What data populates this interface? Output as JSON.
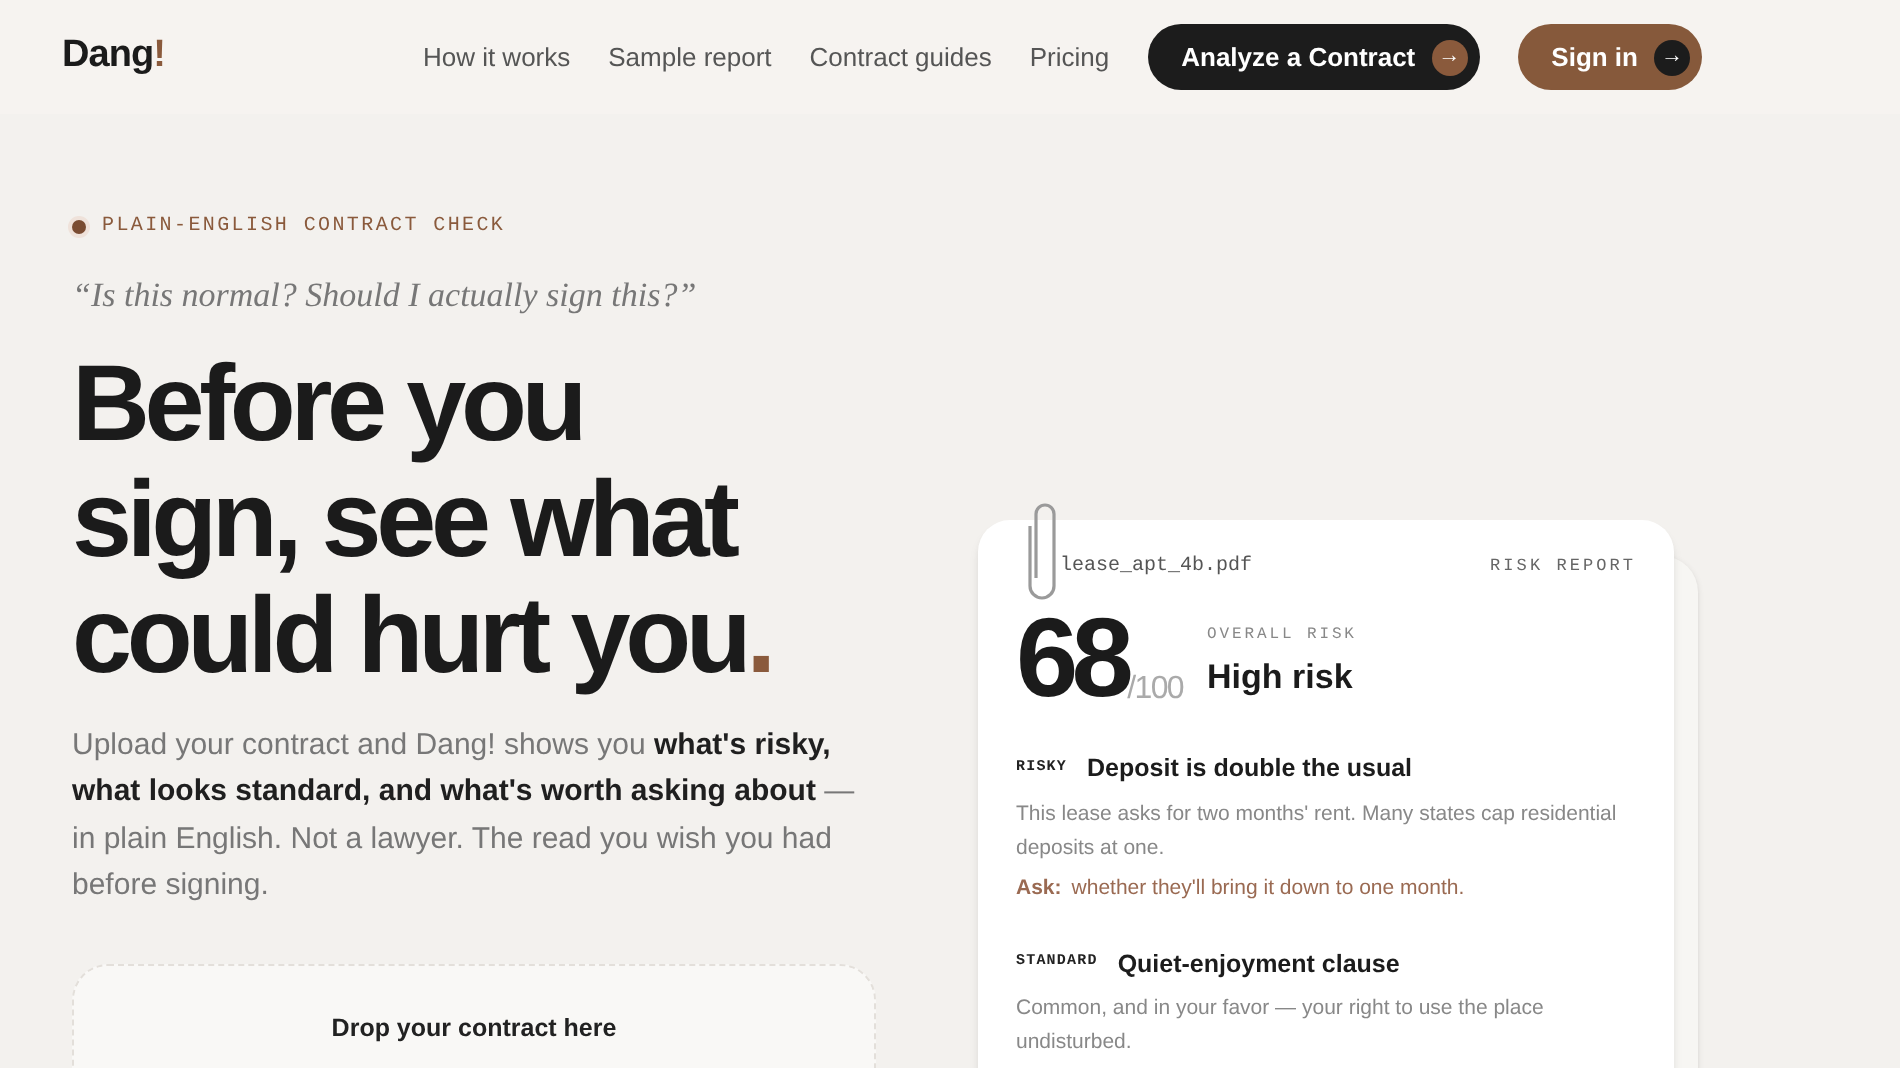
{
  "nav": {
    "logo": "Dang",
    "logo_mark": "!",
    "links": [
      "How it works",
      "Sample report",
      "Contract guides",
      "Pricing"
    ],
    "buttons": [
      {
        "label": "Analyze a Contract",
        "kind": "dark",
        "icon": "→"
      },
      {
        "label": "Sign in",
        "kind": "brown",
        "icon": "→"
      }
    ]
  },
  "hero": {
    "eyebrow": "PLAIN-ENGLISH CONTRACT CHECK",
    "quote": "“Is this normal? Should I actually sign this?”",
    "headline": "Before you sign, see what could hurt you",
    "headline_mark": ".",
    "body": "Upload your contract and Dang! shows you **what's risky, what looks standard, and what's worth asking about** — in plain English. Not a lawyer. The read you wish you had before signing.",
    "dropzone": {
      "title": "Drop your contract here"
    }
  },
  "report": {
    "file": "lease_apt_4b.pdf",
    "label": "RISK REPORT",
    "score": "68",
    "score_max": "/100",
    "overall_label": "OVERALL RISK",
    "overall": "High risk",
    "findings": [
      {
        "tag": "RISKY",
        "title": "Deposit is double the usual",
        "text": "This lease asks for two months' rent. Many states cap residential deposits at one.",
        "ask_label": "Ask:",
        "ask": "whether they'll bring it down to one month."
      },
      {
        "tag": "STANDARD",
        "title": "Quiet-enjoyment clause",
        "text": "Common, and in your favor — your right to use the place undisturbed."
      }
    ]
  }
}
